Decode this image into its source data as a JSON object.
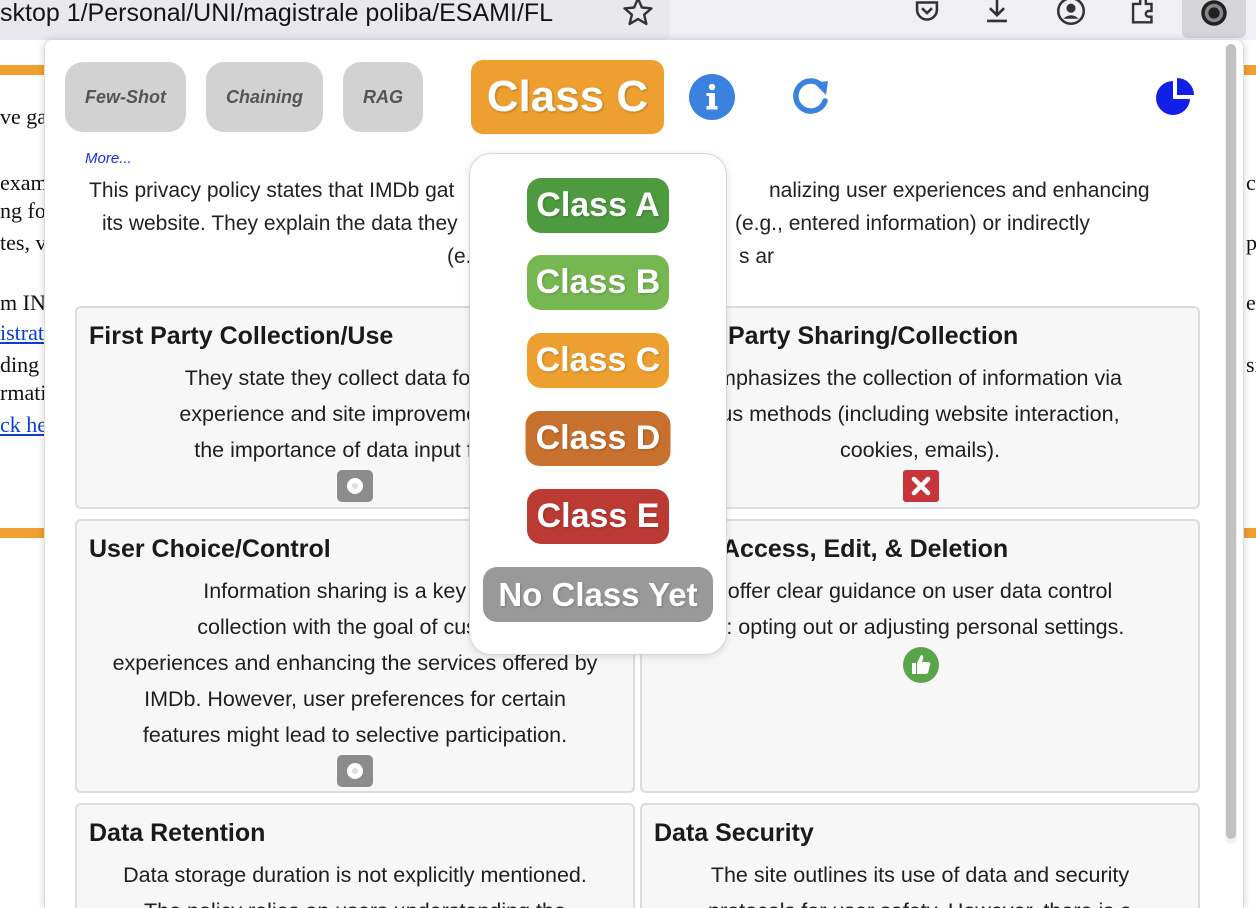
{
  "browser": {
    "url_text": "sktop 1/Personal/UNI/magistrale poliba/ESAMI/FL",
    "icons": [
      "star-icon",
      "pocket-icon",
      "download-icon",
      "account-icon",
      "extensions-icon",
      "extension-badge-icon"
    ]
  },
  "background_page": {
    "lines_left": [
      "ve ga",
      "exam",
      "ng fo",
      "tes, v",
      "m IN",
      "istrat",
      "ding",
      "rmati",
      "ck he"
    ],
    "lines_right": [
      "c",
      "pt",
      "ef",
      "si"
    ]
  },
  "popup": {
    "modes": [
      "Few-Shot",
      "Chaining",
      "RAG"
    ],
    "current_class": "Class C",
    "header_icons": [
      "info-icon",
      "refresh-icon",
      "pie-chart-icon"
    ],
    "more_link": "More...",
    "summary_lines": [
      "This privacy policy states that IMDb gat",
      "nalizing user experiences and enhancing",
      "its website. They explain the data they",
      "(e.g., entered information) or indirectly",
      "(e.",
      "s ar"
    ],
    "cards": [
      {
        "title": "First Party Collection/Use",
        "lines": [
          "They state they collect data for pers",
          "experience and site improvements. It",
          "the importance of data input for fu"
        ],
        "icon": "neutral-icon"
      },
      {
        "title": "Party Sharing/Collection",
        "lines": [
          "mphasizes the collection of information via",
          "us methods (including website interaction,",
          "cookies, emails)."
        ],
        "icon": "negative-x-icon"
      },
      {
        "title": "User Choice/Control",
        "lines": [
          "Information sharing is a key asp",
          "collection with the goal of custom",
          "experiences and enhancing the services offered by",
          "IMDb. However, user preferences for certain",
          "features might lead to selective participation."
        ],
        "icon": "neutral-icon"
      },
      {
        "title": "Access, Edit, & Deletion",
        "lines": [
          "offer clear guidance on user data control",
          "s: opting out or adjusting personal settings."
        ],
        "icon": "thumbs-up-icon"
      },
      {
        "title": "Data Retention",
        "lines": [
          "Data storage duration is not explicitly mentioned.",
          "The policy relies on users understanding the"
        ],
        "icon": ""
      },
      {
        "title": "Data Security",
        "lines": [
          "The site outlines its use of data and security",
          "protocols for user safety. However, there is a"
        ],
        "icon": ""
      }
    ],
    "dropdown": [
      {
        "label": "Class A",
        "color": "#4e9a3f"
      },
      {
        "label": "Class B",
        "color": "#77b752"
      },
      {
        "label": "Class C",
        "color": "#eda030"
      },
      {
        "label": "Class D",
        "color": "#c8702e"
      },
      {
        "label": "Class E",
        "color": "#bb3a33"
      },
      {
        "label": "No Class Yet",
        "color": "#999999"
      }
    ]
  },
  "colors": {
    "accent_orange": "#eda030",
    "info_blue": "#3b82e0",
    "pie_blue": "#1020e8"
  }
}
